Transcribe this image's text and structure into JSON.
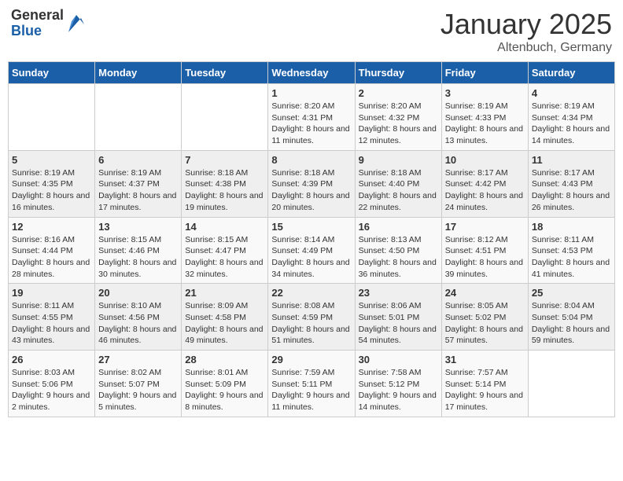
{
  "logo": {
    "general": "General",
    "blue": "Blue"
  },
  "title": "January 2025",
  "subtitle": "Altenbuch, Germany",
  "days_of_week": [
    "Sunday",
    "Monday",
    "Tuesday",
    "Wednesday",
    "Thursday",
    "Friday",
    "Saturday"
  ],
  "weeks": [
    [
      {
        "day": "",
        "info": ""
      },
      {
        "day": "",
        "info": ""
      },
      {
        "day": "",
        "info": ""
      },
      {
        "day": "1",
        "info": "Sunrise: 8:20 AM\nSunset: 4:31 PM\nDaylight: 8 hours and 11 minutes."
      },
      {
        "day": "2",
        "info": "Sunrise: 8:20 AM\nSunset: 4:32 PM\nDaylight: 8 hours and 12 minutes."
      },
      {
        "day": "3",
        "info": "Sunrise: 8:19 AM\nSunset: 4:33 PM\nDaylight: 8 hours and 13 minutes."
      },
      {
        "day": "4",
        "info": "Sunrise: 8:19 AM\nSunset: 4:34 PM\nDaylight: 8 hours and 14 minutes."
      }
    ],
    [
      {
        "day": "5",
        "info": "Sunrise: 8:19 AM\nSunset: 4:35 PM\nDaylight: 8 hours and 16 minutes."
      },
      {
        "day": "6",
        "info": "Sunrise: 8:19 AM\nSunset: 4:37 PM\nDaylight: 8 hours and 17 minutes."
      },
      {
        "day": "7",
        "info": "Sunrise: 8:18 AM\nSunset: 4:38 PM\nDaylight: 8 hours and 19 minutes."
      },
      {
        "day": "8",
        "info": "Sunrise: 8:18 AM\nSunset: 4:39 PM\nDaylight: 8 hours and 20 minutes."
      },
      {
        "day": "9",
        "info": "Sunrise: 8:18 AM\nSunset: 4:40 PM\nDaylight: 8 hours and 22 minutes."
      },
      {
        "day": "10",
        "info": "Sunrise: 8:17 AM\nSunset: 4:42 PM\nDaylight: 8 hours and 24 minutes."
      },
      {
        "day": "11",
        "info": "Sunrise: 8:17 AM\nSunset: 4:43 PM\nDaylight: 8 hours and 26 minutes."
      }
    ],
    [
      {
        "day": "12",
        "info": "Sunrise: 8:16 AM\nSunset: 4:44 PM\nDaylight: 8 hours and 28 minutes."
      },
      {
        "day": "13",
        "info": "Sunrise: 8:15 AM\nSunset: 4:46 PM\nDaylight: 8 hours and 30 minutes."
      },
      {
        "day": "14",
        "info": "Sunrise: 8:15 AM\nSunset: 4:47 PM\nDaylight: 8 hours and 32 minutes."
      },
      {
        "day": "15",
        "info": "Sunrise: 8:14 AM\nSunset: 4:49 PM\nDaylight: 8 hours and 34 minutes."
      },
      {
        "day": "16",
        "info": "Sunrise: 8:13 AM\nSunset: 4:50 PM\nDaylight: 8 hours and 36 minutes."
      },
      {
        "day": "17",
        "info": "Sunrise: 8:12 AM\nSunset: 4:51 PM\nDaylight: 8 hours and 39 minutes."
      },
      {
        "day": "18",
        "info": "Sunrise: 8:11 AM\nSunset: 4:53 PM\nDaylight: 8 hours and 41 minutes."
      }
    ],
    [
      {
        "day": "19",
        "info": "Sunrise: 8:11 AM\nSunset: 4:55 PM\nDaylight: 8 hours and 43 minutes."
      },
      {
        "day": "20",
        "info": "Sunrise: 8:10 AM\nSunset: 4:56 PM\nDaylight: 8 hours and 46 minutes."
      },
      {
        "day": "21",
        "info": "Sunrise: 8:09 AM\nSunset: 4:58 PM\nDaylight: 8 hours and 49 minutes."
      },
      {
        "day": "22",
        "info": "Sunrise: 8:08 AM\nSunset: 4:59 PM\nDaylight: 8 hours and 51 minutes."
      },
      {
        "day": "23",
        "info": "Sunrise: 8:06 AM\nSunset: 5:01 PM\nDaylight: 8 hours and 54 minutes."
      },
      {
        "day": "24",
        "info": "Sunrise: 8:05 AM\nSunset: 5:02 PM\nDaylight: 8 hours and 57 minutes."
      },
      {
        "day": "25",
        "info": "Sunrise: 8:04 AM\nSunset: 5:04 PM\nDaylight: 8 hours and 59 minutes."
      }
    ],
    [
      {
        "day": "26",
        "info": "Sunrise: 8:03 AM\nSunset: 5:06 PM\nDaylight: 9 hours and 2 minutes."
      },
      {
        "day": "27",
        "info": "Sunrise: 8:02 AM\nSunset: 5:07 PM\nDaylight: 9 hours and 5 minutes."
      },
      {
        "day": "28",
        "info": "Sunrise: 8:01 AM\nSunset: 5:09 PM\nDaylight: 9 hours and 8 minutes."
      },
      {
        "day": "29",
        "info": "Sunrise: 7:59 AM\nSunset: 5:11 PM\nDaylight: 9 hours and 11 minutes."
      },
      {
        "day": "30",
        "info": "Sunrise: 7:58 AM\nSunset: 5:12 PM\nDaylight: 9 hours and 14 minutes."
      },
      {
        "day": "31",
        "info": "Sunrise: 7:57 AM\nSunset: 5:14 PM\nDaylight: 9 hours and 17 minutes."
      },
      {
        "day": "",
        "info": ""
      }
    ]
  ]
}
